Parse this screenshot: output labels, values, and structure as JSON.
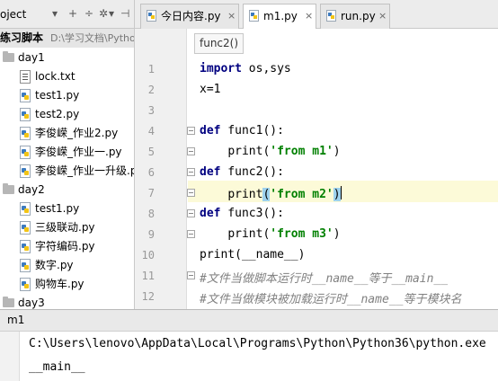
{
  "project_panel": {
    "title": "oject",
    "toolbar": {
      "sync_icon": "+",
      "divider_icon": "÷",
      "settings_icon": "✲",
      "settings_caret": "▾",
      "hide_icon": "⊣"
    },
    "root": {
      "label": "练习脚本",
      "path": "D:\\学习文档\\Pytho"
    },
    "items": [
      {
        "label": "day1",
        "type": "folder"
      },
      {
        "label": "lock.txt",
        "type": "txt"
      },
      {
        "label": "test1.py",
        "type": "py"
      },
      {
        "label": "test2.py",
        "type": "py"
      },
      {
        "label": "李俊嵘_作业2.py",
        "type": "py"
      },
      {
        "label": "李俊嵘_作业一.py",
        "type": "py"
      },
      {
        "label": "李俊嵘_作业一升级.p",
        "type": "py"
      },
      {
        "label": "day2",
        "type": "folder"
      },
      {
        "label": "test1.py",
        "type": "py"
      },
      {
        "label": "三级联动.py",
        "type": "py"
      },
      {
        "label": "字符编码.py",
        "type": "py"
      },
      {
        "label": "数字.py",
        "type": "py"
      },
      {
        "label": "购物车.py",
        "type": "py"
      },
      {
        "label": "day3",
        "type": "folder"
      }
    ]
  },
  "tabs": [
    {
      "label": "今日内容.py",
      "close": "×",
      "active": false
    },
    {
      "label": "m1.py",
      "close": "×",
      "active": true
    },
    {
      "label": "run.py",
      "close": "×",
      "active": false
    }
  ],
  "editor": {
    "breadcrumb_tip": "func2()",
    "line_numbers": [
      "1",
      "2",
      "3",
      "4",
      "5",
      "6",
      "7",
      "8",
      "9",
      "10",
      "11",
      "12"
    ],
    "code": {
      "l1_kw": "import",
      "l1_rest": " os,sys",
      "l2": "x=1",
      "l4_kw": "def",
      "l4_rest": " func1():",
      "l5_indent": "    ",
      "l5_fn": "print(",
      "l5_str": "'from m1'",
      "l5_close": ")",
      "l6_kw": "def",
      "l6_rest": " func2():",
      "l7_indent": "    ",
      "l7_fn": "print",
      "l7_open": "(",
      "l7_str": "'from m2'",
      "l7_close": ")",
      "l8_kw": "def",
      "l8_rest": " func3():",
      "l9_indent": "    ",
      "l9_fn": "print(",
      "l9_str": "'from m3'",
      "l9_close": ")",
      "l10_a": "print(",
      "l10_b": "__name__",
      "l10_c": ")",
      "l11": "#文件当做脚本运行时__name__等于__main__",
      "l12": "#文件当做模块被加载运行时__name__等于模块名"
    }
  },
  "run_panel": {
    "title": "m1",
    "output": [
      "C:\\Users\\lenovo\\AppData\\Local\\Programs\\Python\\Python36\\python.exe",
      "__main__"
    ]
  },
  "colors": {
    "keyword": "#000080",
    "string": "#008000",
    "comment": "#808080",
    "caret_line": "#fcfad8",
    "brace_match": "#9ed2ee"
  }
}
